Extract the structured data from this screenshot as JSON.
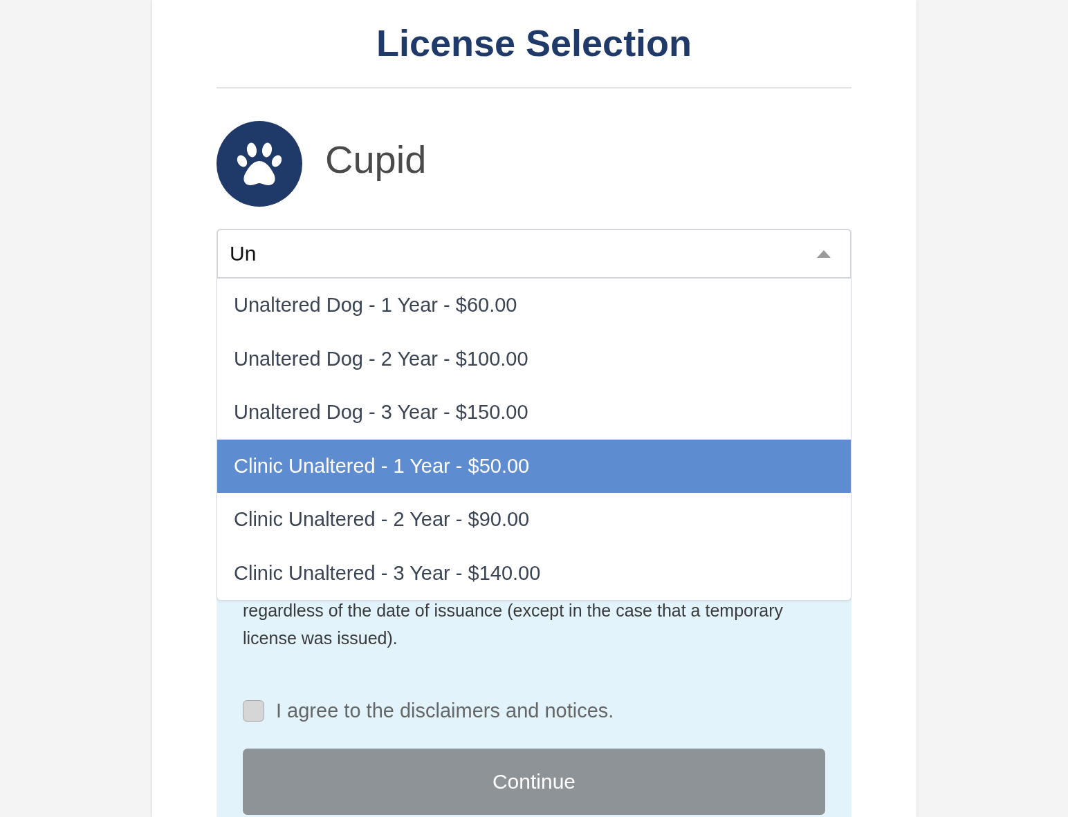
{
  "page": {
    "title": "License Selection"
  },
  "pet": {
    "name": "Cupid"
  },
  "license_select": {
    "value": "Un",
    "expanded": true,
    "options": [
      {
        "label": "Unaltered Dog - 1 Year - $60.00",
        "selected": false
      },
      {
        "label": "Unaltered Dog - 2 Year - $100.00",
        "selected": false
      },
      {
        "label": "Unaltered Dog - 3 Year - $150.00",
        "selected": false
      },
      {
        "label": "Clinic Unaltered - 1 Year - $50.00",
        "selected": true
      },
      {
        "label": "Clinic Unaltered - 2 Year - $90.00",
        "selected": false
      },
      {
        "label": "Clinic Unaltered - 3 Year - $140.00",
        "selected": false
      }
    ]
  },
  "notice": {
    "text": "regardless of the date of issuance (except in the case that a temporary license was issued)."
  },
  "agreement": {
    "label": "I agree to the disclaimers and notices.",
    "checked": false
  },
  "continue_button": {
    "label": "Continue",
    "disabled": true
  }
}
